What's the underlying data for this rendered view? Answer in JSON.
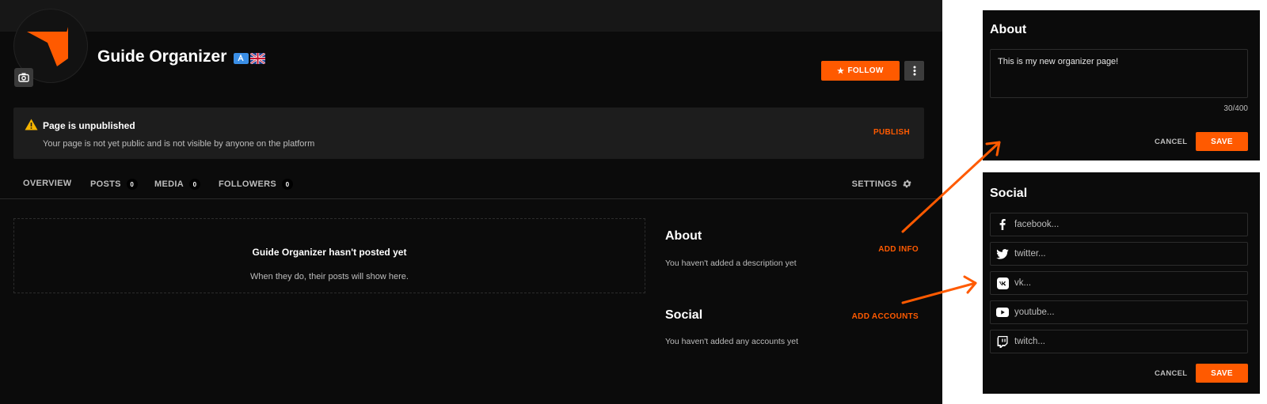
{
  "organizer": {
    "name": "Guide Organizer",
    "follow_label": "FOLLOW"
  },
  "notice": {
    "title": "Page is unpublished",
    "description": "Your page is not yet public and is not visible by anyone on the platform",
    "action": "PUBLISH"
  },
  "tabs": [
    {
      "label": "OVERVIEW"
    },
    {
      "label": "POSTS",
      "count": "0"
    },
    {
      "label": "MEDIA",
      "count": "0"
    },
    {
      "label": "FOLLOWERS",
      "count": "0"
    }
  ],
  "settings_label": "SETTINGS",
  "empty_state": {
    "title": "Guide Organizer hasn't posted yet",
    "description": "When they do, their posts will show here."
  },
  "about": {
    "title": "About",
    "action": "ADD INFO",
    "empty": "You haven't added a description yet"
  },
  "social": {
    "title": "Social",
    "action": "ADD ACCOUNTS",
    "empty": "You haven't added any accounts yet"
  },
  "about_panel": {
    "title": "About",
    "value": "This is my new organizer page!",
    "counter": "30/400",
    "cancel": "CANCEL",
    "save": "SAVE"
  },
  "social_panel": {
    "title": "Social",
    "fields": [
      {
        "icon": "facebook-icon",
        "placeholder": "facebook..."
      },
      {
        "icon": "twitter-icon",
        "placeholder": "twitter..."
      },
      {
        "icon": "vk-icon",
        "placeholder": "vk..."
      },
      {
        "icon": "youtube-icon",
        "placeholder": "youtube..."
      },
      {
        "icon": "twitch-icon",
        "placeholder": "twitch..."
      }
    ],
    "cancel": "CANCEL",
    "save": "SAVE"
  },
  "colors": {
    "accent": "#ff5a00",
    "background": "#0b0b0b",
    "panel_surface": "#1d1d1d"
  }
}
